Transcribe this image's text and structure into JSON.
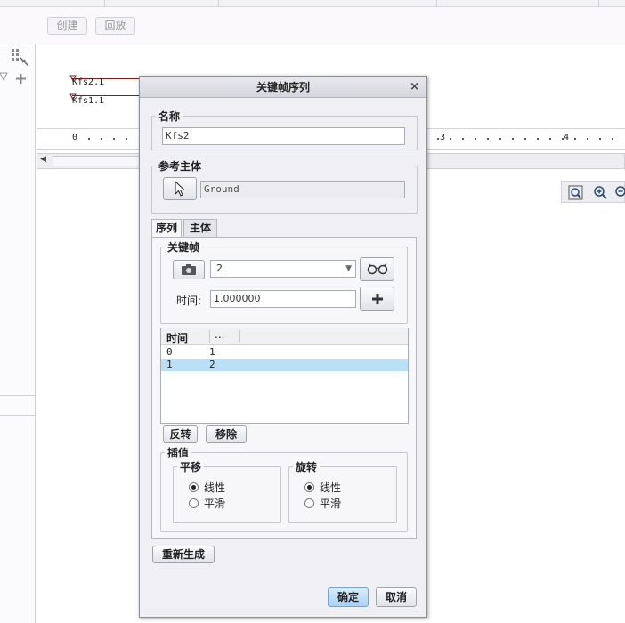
{
  "toolbar": {
    "create_label": "创建",
    "replay_label": "回放"
  },
  "tracks": [
    {
      "label": "Kfs2.1"
    },
    {
      "label": "Kfs1.1"
    }
  ],
  "ruler": {
    "labels": [
      "0",
      "3",
      "4"
    ]
  },
  "dialog": {
    "title": "关键帧序列",
    "close_glyph": "×",
    "name_group": {
      "legend": "名称",
      "value": "Kfs2"
    },
    "ref_group": {
      "legend": "参考主体",
      "value": "Ground"
    },
    "tabs": [
      {
        "label": "序列",
        "active": true
      },
      {
        "label": "主体",
        "active": false
      }
    ],
    "keyframe_group": {
      "legend": "关键帧",
      "selected": "2",
      "time_label": "时间:",
      "time_value": "1.000000"
    },
    "table": {
      "headers": [
        "时间",
        "..."
      ],
      "rows": [
        {
          "time": "0",
          "frame": "1",
          "selected": false
        },
        {
          "time": "1",
          "frame": "2",
          "selected": true
        }
      ]
    },
    "reverse_label": "反转",
    "remove_label": "移除",
    "interp": {
      "legend": "插值",
      "translate": {
        "legend": "平移",
        "options": [
          {
            "label": "线性",
            "checked": true
          },
          {
            "label": "平滑",
            "checked": false
          }
        ]
      },
      "rotate": {
        "legend": "旋转",
        "options": [
          {
            "label": "线性",
            "checked": true
          },
          {
            "label": "平滑",
            "checked": false
          }
        ]
      }
    },
    "regen_label": "重新生成",
    "ok_label": "确定",
    "cancel_label": "取消"
  },
  "icons": [
    "camera-icon",
    "glasses-icon",
    "plus-icon",
    "arrow-cursor-icon",
    "zoom-fit-icon",
    "zoom-in-icon",
    "zoom-out-icon"
  ]
}
